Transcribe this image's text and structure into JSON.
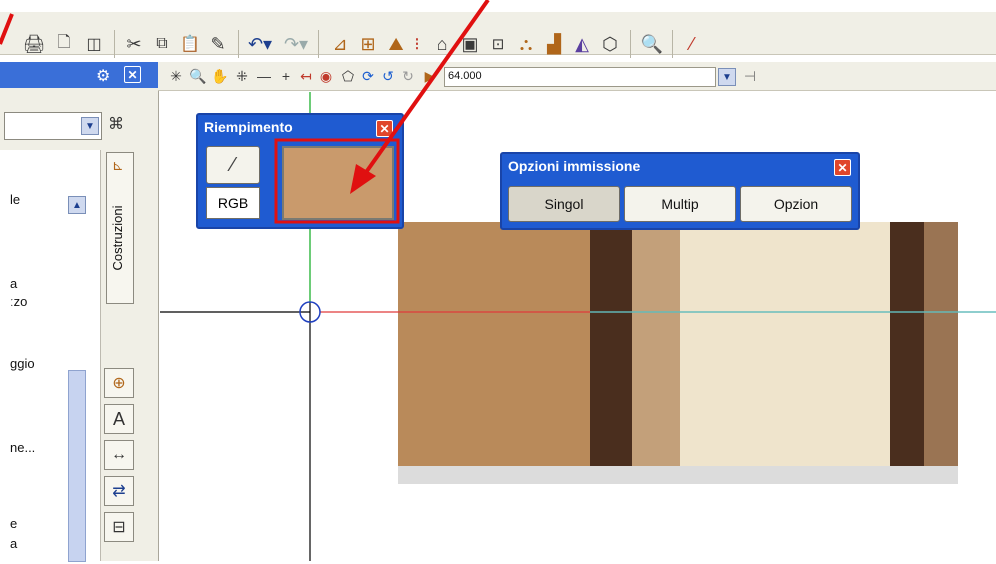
{
  "colors": {
    "panel_bg": "#f0efe6",
    "xp_blue": "#1f5bd1",
    "fill_swatch": "#c99a6c",
    "annotation_red": "#e01010",
    "wall_tan": "#b98a5a",
    "wall_cream": "#efe4cc",
    "pillar_dark": "#4a2e1e"
  },
  "toolbar": {
    "icons_row1": [
      "printer-icon",
      "print-preview-icon",
      "window-icon",
      "cut-icon",
      "copy-icon",
      "paste-icon",
      "format-brush-icon",
      "undo-icon",
      "redo-icon",
      "dimension-icon",
      "dimension2-icon",
      "level-icon",
      "separator-marker-icon",
      "building-icon",
      "camera-icon",
      "render-icon",
      "furniture-icon",
      "stairs-icon",
      "section-icon",
      "3d-icon",
      "help-icon",
      "eyedropper-icon"
    ],
    "zoom_value": "64.000"
  },
  "left_panel": {
    "items": [
      "le",
      "a",
      "ːzo",
      "ggio",
      "ne...",
      "e",
      "a"
    ],
    "vertical_label": "Costruzioni"
  },
  "riempimento": {
    "title": "Riempimento",
    "rgb_label": "RGB"
  },
  "opzioni": {
    "title": "Opzioni immissione",
    "buttons": [
      "Singol",
      "Multip",
      "Opzion"
    ]
  },
  "close_glyph": "✕"
}
